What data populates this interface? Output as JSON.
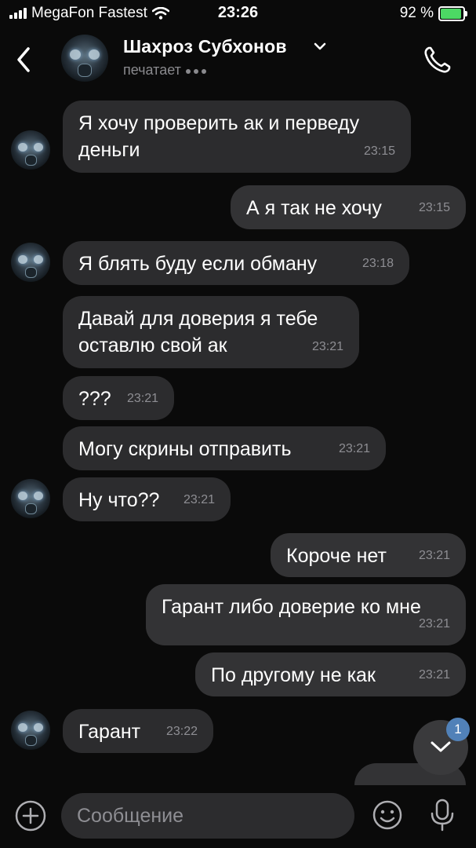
{
  "status_bar": {
    "carrier": "MegaFon Fastest",
    "time": "23:26",
    "battery": "92 %"
  },
  "header": {
    "contact_name": "Шахроз Субхонов",
    "status": "печатает"
  },
  "messages": [
    {
      "text": "Я хочу проверить ак и перведу деньги",
      "time": "23:15"
    },
    {
      "text": "А я так не хочу",
      "time": "23:15"
    },
    {
      "text": "Я блять буду если обману",
      "time": "23:18"
    },
    {
      "text": "Давай для доверия я тебе оставлю свой ак",
      "time": "23:21"
    },
    {
      "text": "???",
      "time": "23:21"
    },
    {
      "text": "Могу скрины отправить",
      "time": "23:21"
    },
    {
      "text": "Ну что??",
      "time": "23:21"
    },
    {
      "text": "Короче нет",
      "time": "23:21"
    },
    {
      "text": "Гарант либо доверие ко мне",
      "time": "23:21"
    },
    {
      "text": "По другому не как",
      "time": "23:21"
    },
    {
      "text": "Гарант",
      "time": "23:22"
    }
  ],
  "scroll_badge": "1",
  "composer": {
    "placeholder": "Сообщение"
  },
  "colors": {
    "background": "#0a0a0a",
    "bubble": "#2c2c2e",
    "accent_badge": "#5181b8",
    "battery_fill": "#4cd964"
  },
  "icons": [
    "back-icon",
    "chevron-down-icon",
    "phone-icon",
    "scroll-down-icon",
    "plus-circle-icon",
    "emoji-icon",
    "microphone-icon"
  ]
}
